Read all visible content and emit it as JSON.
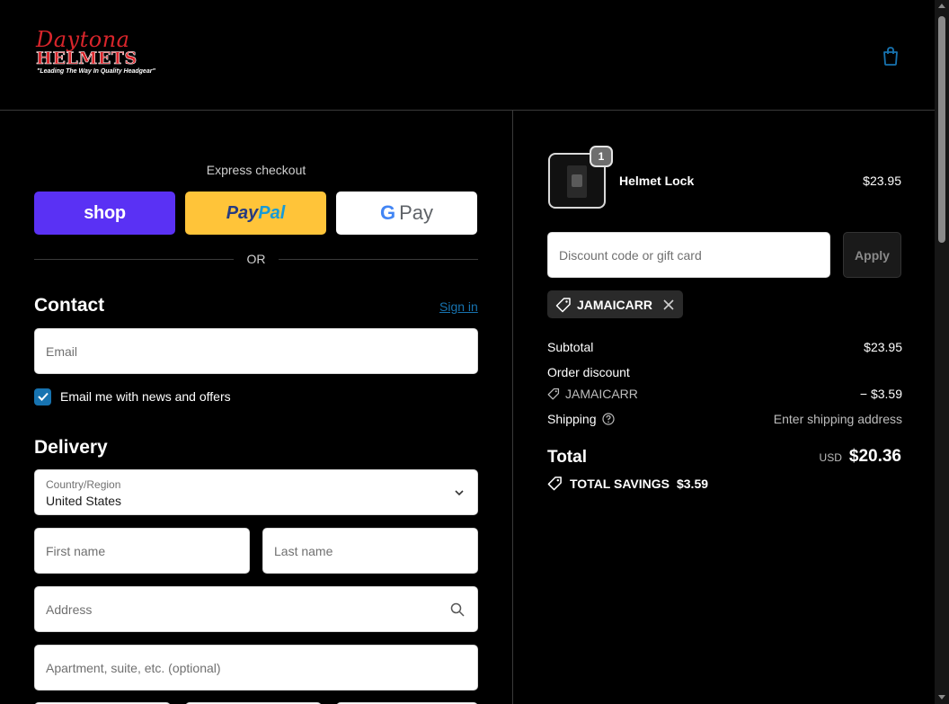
{
  "brand": {
    "script": "Daytona",
    "block": "HELMETS",
    "tagline": "\"Leading The Way In Quality Headgear\""
  },
  "express": {
    "title": "Express checkout",
    "shop_label": "shop",
    "paypal_a": "Pay",
    "paypal_b": "Pal",
    "gpay_g": "G",
    "gpay_pay": "Pay",
    "or_label": "OR"
  },
  "contact": {
    "title": "Contact",
    "sign_in": "Sign in",
    "email_placeholder": "Email",
    "newsletter_label": "Email me with news and offers",
    "newsletter_checked": true
  },
  "delivery": {
    "title": "Delivery",
    "country_label": "Country/Region",
    "country_value": "United States",
    "first_name_placeholder": "First name",
    "last_name_placeholder": "Last name",
    "address_placeholder": "Address",
    "apartment_placeholder": "Apartment, suite, etc. (optional)"
  },
  "order": {
    "item": {
      "name": "Helmet Lock",
      "price": "$23.95",
      "qty": "1"
    },
    "discount_placeholder": "Discount code or gift card",
    "apply_label": "Apply",
    "applied_code": "JAMAICARR",
    "subtotal_label": "Subtotal",
    "subtotal_value": "$23.95",
    "order_discount_label": "Order discount",
    "discount_code": "JAMAICARR",
    "discount_value": "− $3.59",
    "shipping_label": "Shipping",
    "shipping_value": "Enter shipping address",
    "total_label": "Total",
    "total_currency": "USD",
    "total_value": "$20.36",
    "savings_label": "TOTAL SAVINGS",
    "savings_value": "$3.59"
  },
  "colors": {
    "background": "#000000",
    "link": "#1773b0",
    "shop": "#5a31f4",
    "paypal": "#ffc439"
  }
}
